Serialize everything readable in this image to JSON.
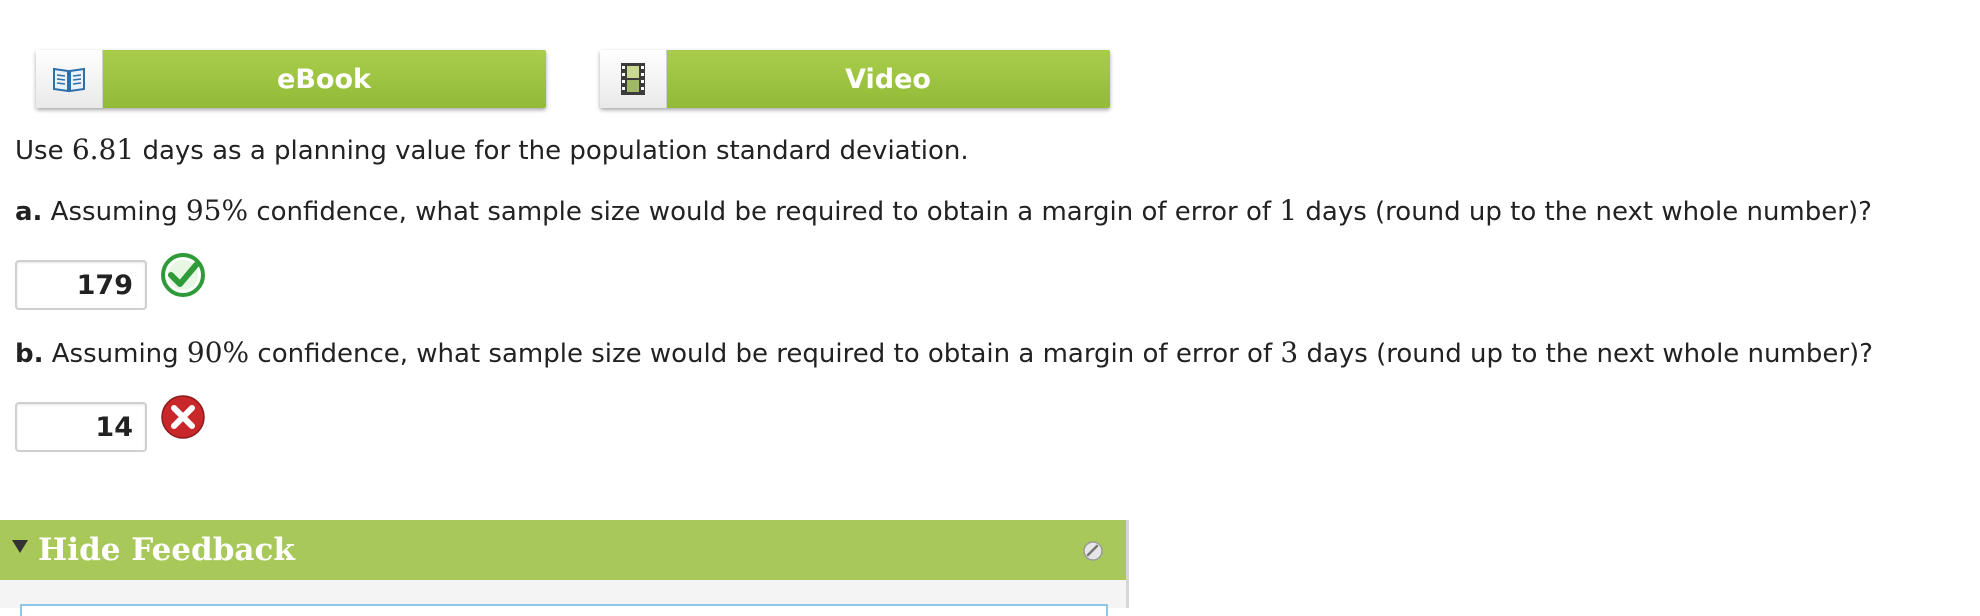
{
  "resources": {
    "ebook_label": "eBook",
    "video_label": "Video",
    "ebook_icon": "book-icon",
    "video_icon": "film-icon"
  },
  "intro": {
    "prefix": "Use ",
    "value": "6.81",
    "suffix": " days as a planning value for the population standard deviation."
  },
  "part_a": {
    "letter": "a.",
    "text1": " Assuming ",
    "confidence": "95%",
    "text2": " confidence, what sample size would be required to obtain a margin of error of ",
    "margin": "1",
    "text3": " days (round up to the next whole number)?",
    "answer": "179",
    "status": "correct"
  },
  "part_b": {
    "letter": "b.",
    "text1": " Assuming ",
    "confidence": "90%",
    "text2": " confidence, what sample size would be required to obtain a margin of error of ",
    "margin": "3",
    "text3": " days (round up to the next whole number)?",
    "answer": "14",
    "status": "incorrect"
  },
  "feedback": {
    "title": "Hide Feedback"
  },
  "colors": {
    "accent_green": "#9cc33f",
    "correct_green": "#3aa83a",
    "incorrect_red": "#c8282a"
  }
}
